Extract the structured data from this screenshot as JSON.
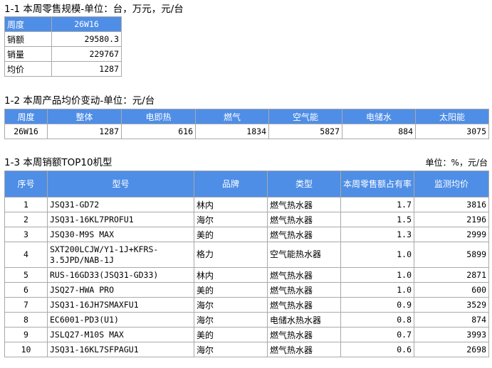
{
  "section1": {
    "title": "1-1 本周零售规模-单位：台，万元，元/台",
    "rows": [
      {
        "label": "周度",
        "value": "26W16"
      },
      {
        "label": "销额",
        "value": "29580.3"
      },
      {
        "label": "销量",
        "value": "229767"
      },
      {
        "label": "均价",
        "value": "1287"
      }
    ]
  },
  "section2": {
    "title": "1-2 本周产品均价变动-单位：元/台",
    "headers": [
      "周度",
      "整体",
      "电即热",
      "燃气",
      "空气能",
      "电储水",
      "太阳能"
    ],
    "row": [
      "26W16",
      "1287",
      "616",
      "1834",
      "5827",
      "884",
      "3075"
    ]
  },
  "section3": {
    "title": "1-3 本周销额TOP10机型",
    "unit": "单位：%，元/台",
    "headers": [
      "序号",
      "型号",
      "品牌",
      "类型",
      "本周零售额占有率",
      "监测均价"
    ],
    "rows": [
      [
        "1",
        "JSQ31-GD72",
        "林内",
        "燃气热水器",
        "1.7",
        "3816"
      ],
      [
        "2",
        "JSQ31-16KL7PROFU1",
        "海尔",
        "燃气热水器",
        "1.5",
        "2196"
      ],
      [
        "3",
        "JSQ30-M9S MAX",
        "美的",
        "燃气热水器",
        "1.3",
        "2999"
      ],
      [
        "4",
        "SXT200LCJW/Y1-1J+KFRS-3.5JPD/NAB-1J",
        "格力",
        "空气能热水器",
        "1.0",
        "5899"
      ],
      [
        "5",
        "RUS-16GD33(JSQ31-GD33)",
        "林内",
        "燃气热水器",
        "1.0",
        "2871"
      ],
      [
        "6",
        "JSQ27-HWA PRO",
        "美的",
        "燃气热水器",
        "1.0",
        "600"
      ],
      [
        "7",
        "JSQ31-16JH7SMAXFU1",
        "海尔",
        "燃气热水器",
        "0.9",
        "3529"
      ],
      [
        "8",
        "EC6001-PD3(U1)",
        "海尔",
        "电储水热水器",
        "0.8",
        "874"
      ],
      [
        "9",
        "JSLQ27-M10S MAX",
        "美的",
        "燃气热水器",
        "0.7",
        "3993"
      ],
      [
        "10",
        "JSQ31-16KL7SFPAGU1",
        "海尔",
        "燃气热水器",
        "0.6",
        "2698"
      ]
    ]
  }
}
